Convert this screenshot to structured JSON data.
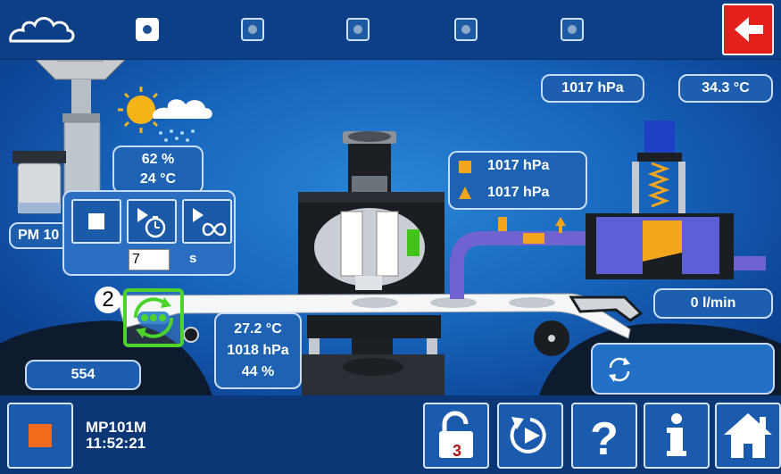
{
  "header": {
    "icons": [
      "cloud-icon",
      "arrow-left-icon"
    ],
    "steps": [
      {
        "name": "step-1",
        "active": true
      },
      {
        "name": "step-2",
        "active": false
      },
      {
        "name": "step-3",
        "active": false
      },
      {
        "name": "step-4",
        "active": false
      },
      {
        "name": "step-5",
        "active": false
      }
    ]
  },
  "readings": {
    "pressure_top": "1017 hPa",
    "temperature_top": "34.3 °C",
    "weather_humidity": "62 %",
    "weather_temp": "24 °C",
    "sensor_pressure_1": "1017 hPa",
    "sensor_pressure_2": "1017 hPa",
    "flow": "0 l/min",
    "chamber_temp": "27.2 °C",
    "chamber_pressure": "1018 hPa",
    "chamber_humidity": "44 %",
    "counter": "554"
  },
  "pm_label": "PM 10",
  "timer_panel": {
    "icons": [
      "stop-icon",
      "play-timer-icon",
      "play-infinite-icon"
    ],
    "seconds_value": "7",
    "unit": "s"
  },
  "filter_position": "2",
  "status": {
    "device": "MP101M",
    "time": "11:52:21"
  },
  "lock_badge": "3",
  "toolbar_icons": [
    "unlock-icon",
    "replay-icon",
    "help-icon",
    "info-icon",
    "home-icon"
  ],
  "colors": {
    "stop_accent": "#f26b1d",
    "back_button": "#e3201b",
    "highlight": "#4cd42a",
    "sensor_marker": "#f3a51c"
  }
}
